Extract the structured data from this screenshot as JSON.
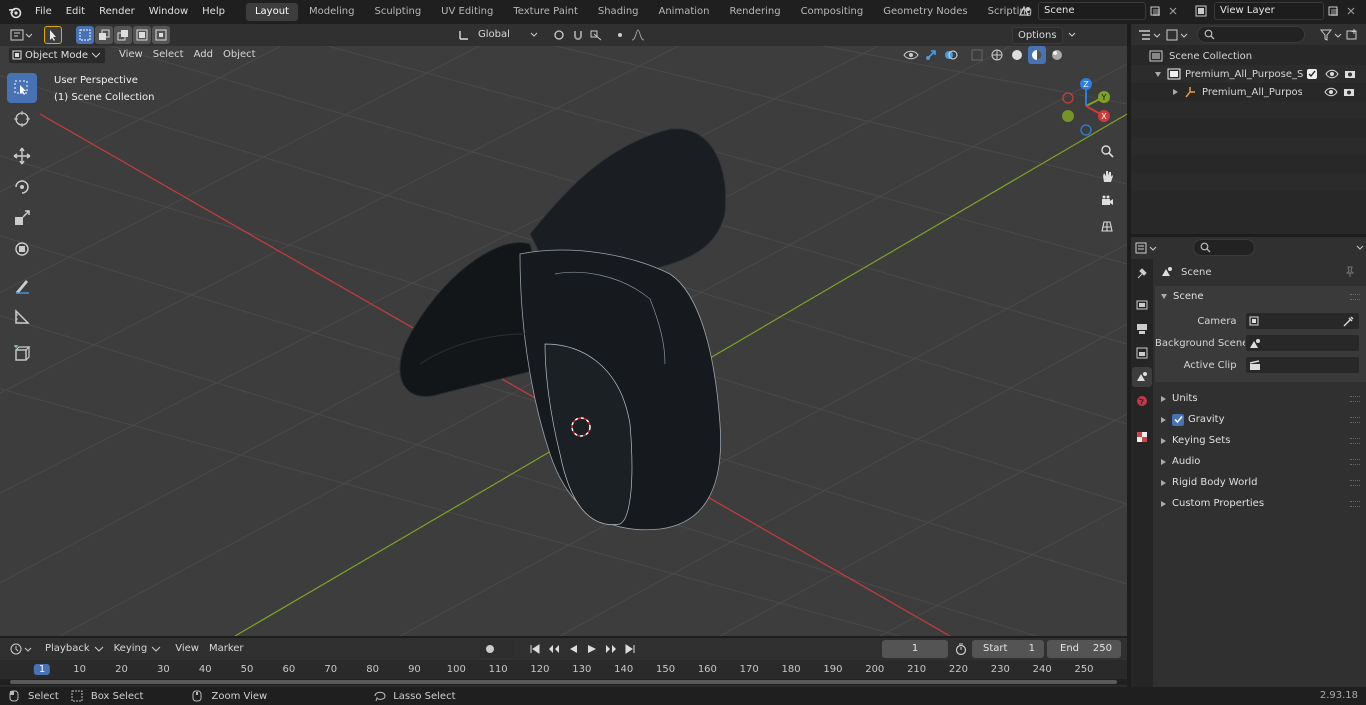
{
  "topbar": {
    "menus": [
      "File",
      "Edit",
      "Render",
      "Window",
      "Help"
    ],
    "workspaces": [
      "Layout",
      "Modeling",
      "Sculpting",
      "UV Editing",
      "Texture Paint",
      "Shading",
      "Animation",
      "Rendering",
      "Compositing",
      "Geometry Nodes",
      "Scripting"
    ],
    "active_workspace": "Layout",
    "add_tab": "+",
    "scene_name": "Scene",
    "view_layer": "View Layer"
  },
  "viewport_header": {
    "mode": "Object Mode",
    "menus": [
      "View",
      "Select",
      "Add",
      "Object"
    ],
    "transform_orientation": "Global",
    "options_label": "Options"
  },
  "viewport": {
    "perspective_label": "User Perspective",
    "collection_label": "(1) Scene Collection",
    "gizmo": {
      "x": "X",
      "y": "Y",
      "z": "Z"
    }
  },
  "outliner": {
    "scene_collection": "Scene Collection",
    "items": [
      {
        "label": "Premium_All_Purpose_Saddle"
      },
      {
        "label": "Premium_All_Purpose_Sa"
      }
    ]
  },
  "properties": {
    "breadcrumb": "Scene",
    "section": "Scene",
    "fields": [
      {
        "label": "Camera",
        "value": ""
      },
      {
        "label": "Background Scene",
        "value": ""
      },
      {
        "label": "Active Clip",
        "value": ""
      }
    ],
    "panels": [
      {
        "label": "Units",
        "checkbox": false
      },
      {
        "label": "Gravity",
        "checkbox": true
      },
      {
        "label": "Keying Sets",
        "checkbox": false
      },
      {
        "label": "Audio",
        "checkbox": false
      },
      {
        "label": "Rigid Body World",
        "checkbox": false
      },
      {
        "label": "Custom Properties",
        "checkbox": false
      }
    ]
  },
  "timeline": {
    "menus": [
      "Playback",
      "Keying",
      "View",
      "Marker"
    ],
    "current_frame": "1",
    "start_label": "Start",
    "start_value": "1",
    "end_label": "End",
    "end_value": "250",
    "ticks": [
      "1",
      "10",
      "20",
      "30",
      "40",
      "50",
      "60",
      "70",
      "80",
      "90",
      "100",
      "110",
      "120",
      "130",
      "140",
      "150",
      "160",
      "170",
      "180",
      "190",
      "200",
      "210",
      "220",
      "230",
      "240",
      "250"
    ]
  },
  "statusbar": {
    "items": [
      "Select",
      "Box Select",
      "Zoom View",
      "Lasso Select"
    ],
    "version": "2.93.18"
  },
  "colors": {
    "accent": "#4772b3",
    "x_axis": "#cc3b3b",
    "y_axis": "#7ea224",
    "z_axis": "#2d7de0",
    "viewport_bg": "#3d3d3d"
  }
}
